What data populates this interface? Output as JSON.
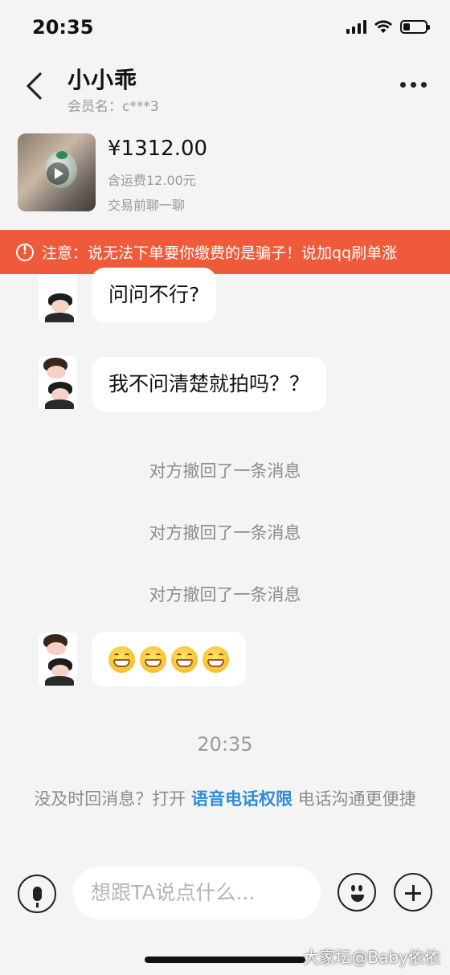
{
  "status_bar": {
    "time": "20:35"
  },
  "header": {
    "title": "小小乖",
    "member_label": "会员名：",
    "member_name": "c***3"
  },
  "product": {
    "price": "¥1312.00",
    "shipping": "含运费12.00元",
    "hint": "交易前聊一聊"
  },
  "warning": {
    "label": "注意：",
    "text": "说无法下单要你缴费的是骗子！说加qq刷单涨"
  },
  "messages": [
    {
      "type": "received",
      "text": "问问不行?"
    },
    {
      "type": "received",
      "text": "我不问清楚就拍吗？？"
    },
    {
      "type": "system",
      "text": "对方撤回了一条消息"
    },
    {
      "type": "system",
      "text": "对方撤回了一条消息"
    },
    {
      "type": "system",
      "text": "对方撤回了一条消息"
    },
    {
      "type": "received_emoji",
      "emojis": [
        "grin-emoji",
        "grin-emoji",
        "grin-emoji",
        "grin-emoji"
      ]
    }
  ],
  "timestamp": "20:35",
  "notice": {
    "before": "没及时回消息？打开 ",
    "link": "语音电话权限",
    "after": " 电话沟通更便捷"
  },
  "input": {
    "placeholder": "想跟TA说点什么..."
  },
  "watermark": "大家坛@Baby依依",
  "colors": {
    "warning_bg": "#ee5a3a",
    "link": "#2f8bd8",
    "background": "#f4f4f4"
  },
  "icons": [
    "back-arrow-icon",
    "more-dots-icon",
    "play-icon",
    "warning-icon",
    "microphone-icon",
    "emoji-icon",
    "plus-icon"
  ]
}
